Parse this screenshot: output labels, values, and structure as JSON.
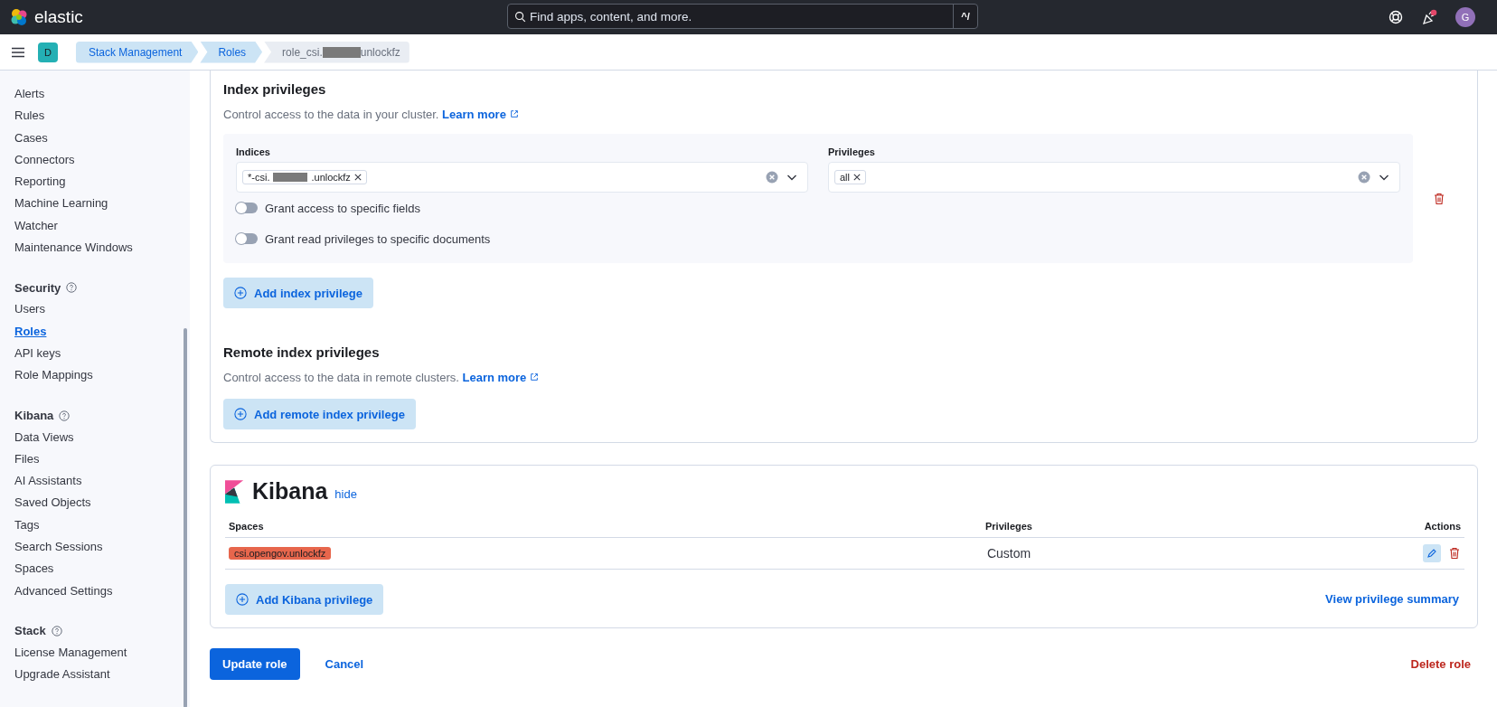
{
  "header": {
    "logo_text": "elastic",
    "search": {
      "placeholder": "Find apps, content, and more.",
      "shortcut": "^/"
    },
    "avatar": "G"
  },
  "breadcrumbs": {
    "space_badge": "D",
    "items": [
      {
        "parts": [
          "Stack Management"
        ],
        "current": false
      },
      {
        "parts": [
          "Roles"
        ],
        "current": false
      },
      {
        "parts": [
          "role_csi.",
          "unlockfz"
        ],
        "current": true
      }
    ]
  },
  "sidebar": {
    "sections": [
      {
        "items": [
          {
            "label": "Alerts",
            "selected": false
          },
          {
            "label": "Rules",
            "selected": false
          },
          {
            "label": "Cases",
            "selected": false
          },
          {
            "label": "Connectors",
            "selected": false
          },
          {
            "label": "Reporting",
            "selected": false
          },
          {
            "label": "Machine Learning",
            "selected": false
          },
          {
            "label": "Watcher",
            "selected": false
          },
          {
            "label": "Maintenance Windows",
            "selected": false
          }
        ]
      },
      {
        "title": "Security",
        "items": [
          {
            "label": "Users",
            "selected": false
          },
          {
            "label": "Roles",
            "selected": true
          },
          {
            "label": "API keys",
            "selected": false
          },
          {
            "label": "Role Mappings",
            "selected": false
          }
        ]
      },
      {
        "title": "Kibana",
        "items": [
          {
            "label": "Data Views",
            "selected": false
          },
          {
            "label": "Files",
            "selected": false
          },
          {
            "label": "AI Assistants",
            "selected": false
          },
          {
            "label": "Saved Objects",
            "selected": false
          },
          {
            "label": "Tags",
            "selected": false
          },
          {
            "label": "Search Sessions",
            "selected": false
          },
          {
            "label": "Spaces",
            "selected": false
          },
          {
            "label": "Advanced Settings",
            "selected": false
          }
        ]
      },
      {
        "title": "Stack",
        "items": [
          {
            "label": "License Management",
            "selected": false
          },
          {
            "label": "Upgrade Assistant",
            "selected": false
          }
        ]
      }
    ]
  },
  "index_privileges": {
    "title": "Index privileges",
    "description": "Control access to the data in your cluster.",
    "learn_more": "Learn more",
    "indices": {
      "label": "Indices",
      "chips": [
        {
          "parts": [
            "*-csi.",
            ".unlockfz"
          ]
        }
      ]
    },
    "privileges": {
      "label": "Privileges",
      "chips": [
        {
          "parts": [
            "all"
          ]
        }
      ]
    },
    "toggles": [
      {
        "label": "Grant access to specific fields",
        "on": false
      },
      {
        "label": "Grant read privileges to specific documents",
        "on": false
      }
    ],
    "add_button": "Add index privilege"
  },
  "remote_index_privileges": {
    "title": "Remote index privileges",
    "description": "Control access to the data in remote clusters.",
    "learn_more": "Learn more",
    "add_button": "Add remote index privilege"
  },
  "kibana": {
    "title": "Kibana",
    "hide_link": "hide",
    "columns": [
      "Spaces",
      "Privileges",
      "Actions"
    ],
    "rows": [
      {
        "space": "csi.opengov.unlockfz",
        "color": "#e7664c",
        "privilege": "Custom"
      }
    ],
    "add_button": "Add Kibana privilege",
    "summary_link": "View privilege summary"
  },
  "footer": {
    "update": "Update role",
    "cancel": "Cancel",
    "delete": "Delete role"
  }
}
